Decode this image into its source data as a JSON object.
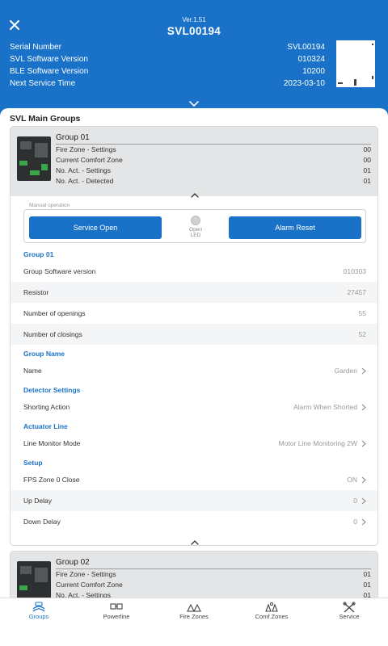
{
  "header": {
    "version": "Ver.1.51",
    "title": "SVL00194",
    "info": [
      {
        "label": "Serial Number",
        "value": "SVL00194"
      },
      {
        "label": "SVL Software Version",
        "value": "010324"
      },
      {
        "label": "BLE Software Version",
        "value": "10200"
      },
      {
        "label": "Next Service Time",
        "value": "2023-03-10"
      }
    ]
  },
  "main": {
    "section_title": "SVL Main Groups",
    "groups": [
      {
        "name": "Group 01",
        "stats": [
          {
            "label": "Fire Zone - Settings",
            "value": "00"
          },
          {
            "label": "Current Comfort Zone",
            "value": "00"
          },
          {
            "label": "No. Act. - Settings",
            "value": "01"
          },
          {
            "label": "No. Act. - Detected",
            "value": "01"
          }
        ],
        "manual_operation": {
          "label": "Manual operation",
          "service_open": "Service Open",
          "led_label": "Open\nLED",
          "alarm_reset": "Alarm Reset"
        },
        "info_heading": "Group 01",
        "info_rows": [
          {
            "label": "Group Software version",
            "value": "010303"
          },
          {
            "label": "Resistor",
            "value": "27457"
          },
          {
            "label": "Number of openings",
            "value": "55"
          },
          {
            "label": "Number of closings",
            "value": "52"
          }
        ],
        "group_name_heading": "Group Name",
        "name_row": {
          "label": "Name",
          "value": "Garden"
        },
        "detector_heading": "Detector Settings",
        "detector_row": {
          "label": "Shorting Action",
          "value": "Alarm When Shorted"
        },
        "actuator_heading": "Actuator Line",
        "actuator_row": {
          "label": "Line Monitor Mode",
          "value": "Motor Line Monitoring 2W"
        },
        "setup_heading": "Setup",
        "setup_rows": [
          {
            "label": "FPS Zone 0 Close",
            "value": "ON"
          },
          {
            "label": "Up Delay",
            "value": "0"
          },
          {
            "label": "Down Delay",
            "value": "0"
          }
        ]
      },
      {
        "name": "Group 02",
        "stats": [
          {
            "label": "Fire Zone - Settings",
            "value": "01"
          },
          {
            "label": "Current Comfort Zone",
            "value": "01"
          },
          {
            "label": "No. Act. - Settings",
            "value": "01"
          }
        ]
      }
    ]
  },
  "bottom_nav": [
    {
      "label": "Groups",
      "icon": "groups-icon",
      "active": true
    },
    {
      "label": "Powerline",
      "icon": "powerline-icon",
      "active": false
    },
    {
      "label": "Fire Zones",
      "icon": "fire-zones-icon",
      "active": false
    },
    {
      "label": "Comf.Zones",
      "icon": "comfort-zones-icon",
      "active": false
    },
    {
      "label": "Service",
      "icon": "service-icon",
      "active": false
    }
  ],
  "colors": {
    "accent": "#1a72c8",
    "heading_blue": "#1a72c8"
  }
}
